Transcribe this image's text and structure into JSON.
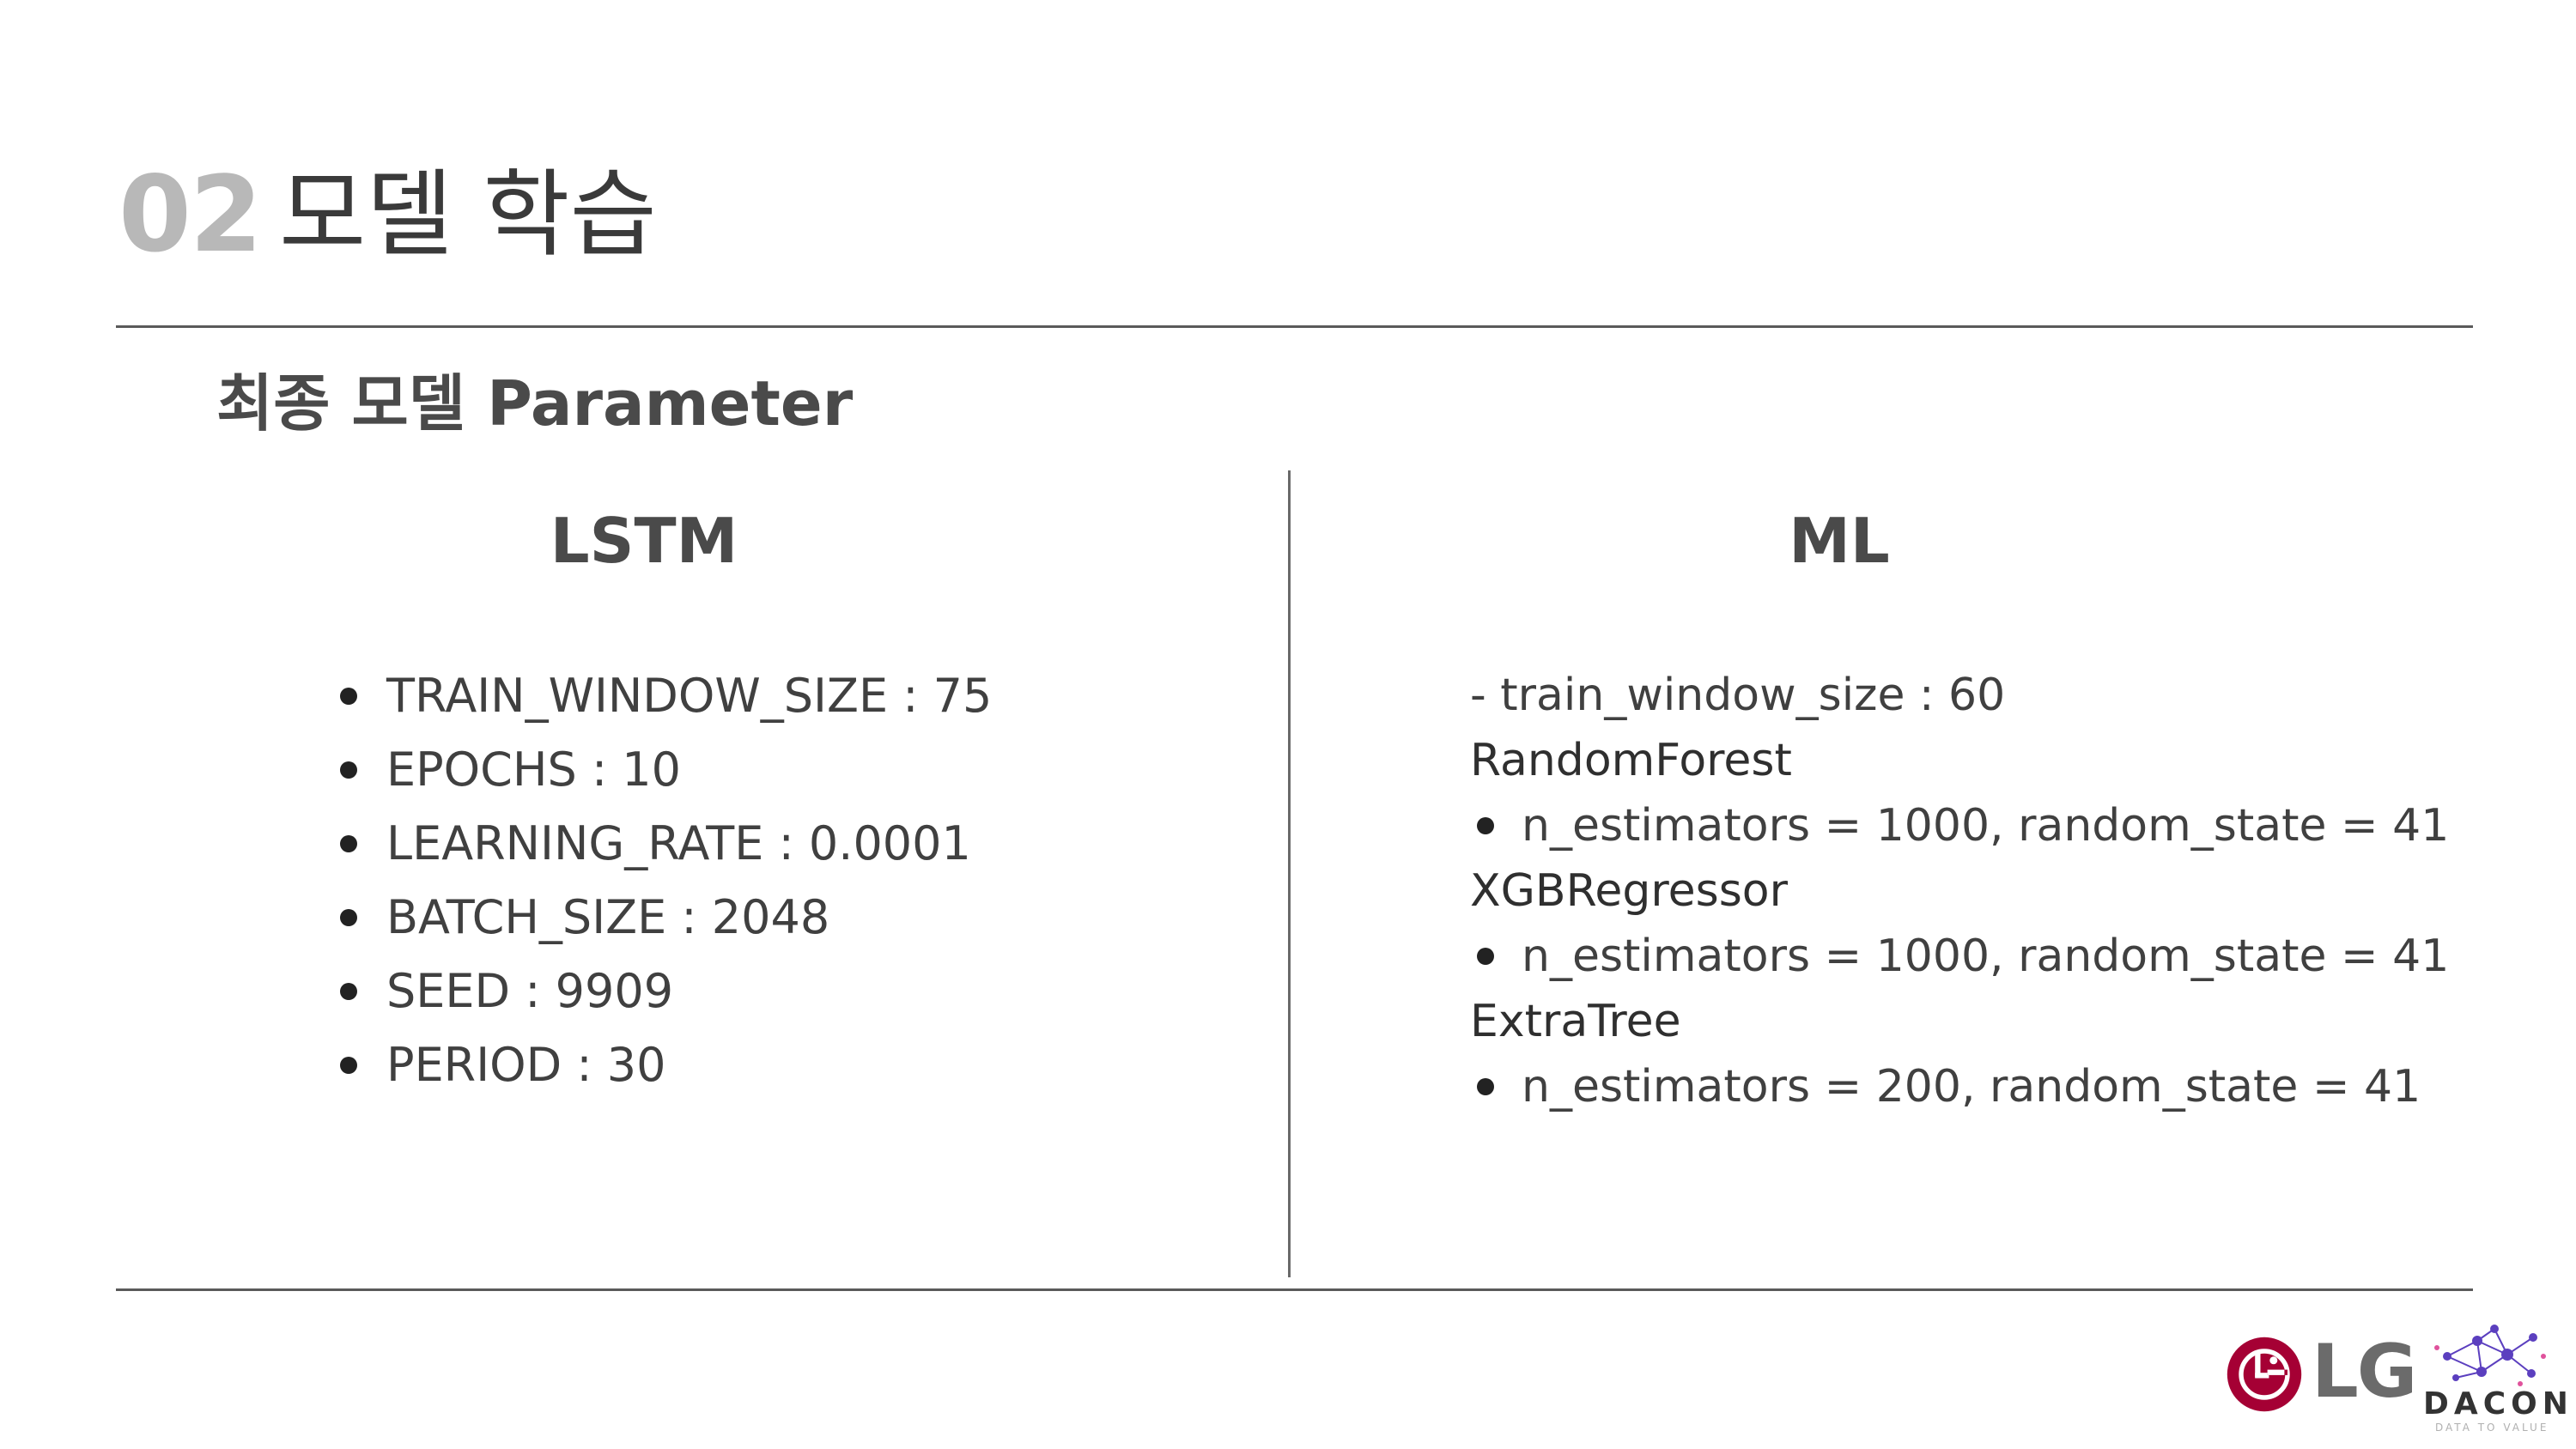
{
  "header": {
    "section_number": "02",
    "section_title": "모델 학습"
  },
  "subheading": "최종 모델 Parameter",
  "lstm": {
    "title": "LSTM",
    "params": [
      "TRAIN_WINDOW_SIZE : 75",
      "EPOCHS : 10",
      "LEARNING_RATE : 0.0001",
      "BATCH_SIZE : 2048",
      "SEED : 9909",
      "PERIOD : 30"
    ]
  },
  "ml": {
    "title": "ML",
    "window_line": "- train_window_size : 60",
    "models": [
      {
        "name": "RandomForest",
        "params": "n_estimators = 1000, random_state = 41"
      },
      {
        "name": "XGBRegressor",
        "params": "n_estimators = 1000, random_state = 41"
      },
      {
        "name": "ExtraTree",
        "params": "n_estimators = 200, random_state = 41"
      }
    ]
  },
  "logos": {
    "lg_text": "LG",
    "dacon_text": "DACON",
    "dacon_tagline": "DATA TO VALUE",
    "lg_color": "#a50034",
    "dacon_color": "#5b3fbf"
  }
}
